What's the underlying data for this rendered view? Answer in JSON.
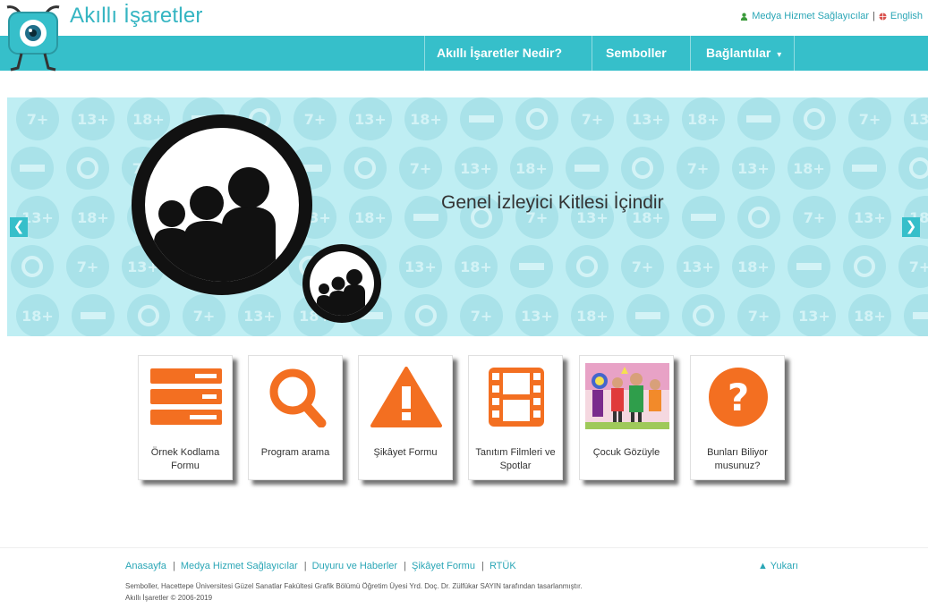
{
  "header": {
    "site_title": "Akıllı İşaretler",
    "providers_link": "Medya Hizmet Sağlayıcılar",
    "separator": "|",
    "english_link": "English"
  },
  "nav": {
    "items": [
      {
        "label": "Akıllı İşaretler Nedir?"
      },
      {
        "label": "Semboller"
      },
      {
        "label": "Bağlantılar"
      }
    ],
    "dropdown_caret": "▾"
  },
  "carousel": {
    "caption": "Genel İzleyici Kitlesi İçindir",
    "prev_arrow": "❮",
    "next_arrow": "❯",
    "pattern_labels": [
      "7+",
      "13+",
      "18+"
    ]
  },
  "tiles": [
    {
      "label": "Örnek Kodlama Formu",
      "icon": "form-list-icon"
    },
    {
      "label": "Program arama",
      "icon": "search-icon"
    },
    {
      "label": "Şikâyet Formu",
      "icon": "warning-icon"
    },
    {
      "label": "Tanıtım Filmleri ve Spotlar",
      "icon": "film-icon"
    },
    {
      "label": "Çocuk Gözüyle",
      "icon": "child-drawing-icon"
    },
    {
      "label": "Bunları Biliyor musunuz?",
      "icon": "question-icon"
    }
  ],
  "footer": {
    "links": [
      "Anasayfa",
      "Medya Hizmet Sağlayıcılar",
      "Duyuru ve Haberler",
      "Şikâyet Formu",
      "RTÜK"
    ],
    "link_separator": "|",
    "to_top": "▲ Yukarı",
    "credit": "Semboller, Hacettepe Üniversitesi Güzel Sanatlar Fakültesi Grafik Bölümü Öğretim Üyesi Yrd. Doç. Dr. Zülfükar SAYIN tarafından tasarlanmıştır.",
    "copyright": "Akıllı İşaretler © 2006-2019"
  },
  "colors": {
    "accent": "#36bfca",
    "link": "#2aa6b6",
    "carousel_bg": "#bfeef3",
    "tile_orange": "#f36f21"
  }
}
